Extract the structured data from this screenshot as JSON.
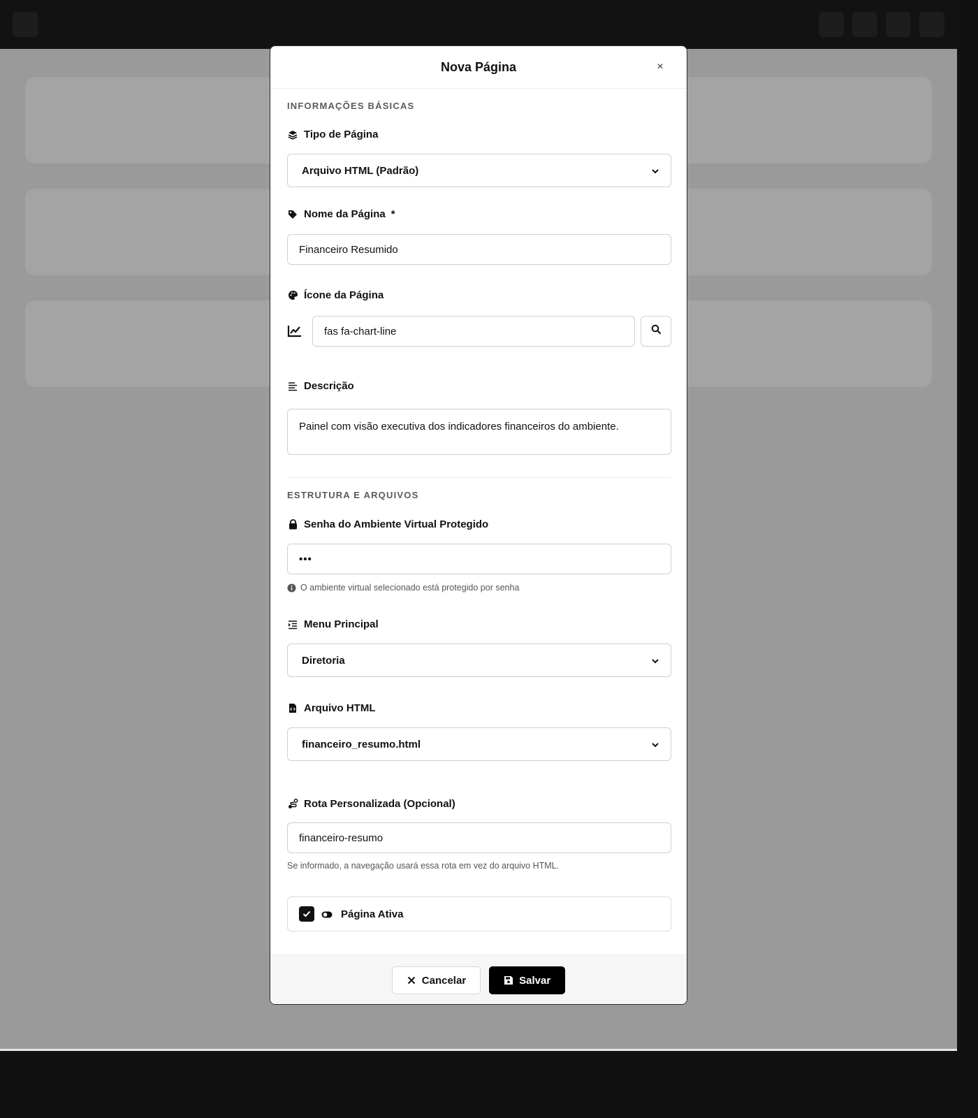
{
  "modal": {
    "title": "Nova Página",
    "close_label": "×"
  },
  "sections": {
    "basic": "INFORMAÇÕES BÁSICAS",
    "structure": "ESTRUTURA E ARQUIVOS"
  },
  "fields": {
    "page_type": {
      "label": "Tipo de Página",
      "value": "Arquivo HTML (Padrão)",
      "icon": "layers-icon"
    },
    "page_name": {
      "label": "Nome da Página",
      "required_mark": "*",
      "value": "Financeiro Resumido",
      "icon": "tag-icon"
    },
    "page_icon": {
      "label": "Ícone da Página",
      "value": "fas fa-chart-line",
      "icon": "palette-icon",
      "preview_icon": "chart-line-icon"
    },
    "description": {
      "label": "Descrição",
      "value": "Painel com visão executiva dos indicadores financeiros do ambiente.",
      "icon": "align-left-icon"
    },
    "password": {
      "label": "Senha do Ambiente Virtual Protegido",
      "value": "•••",
      "help": "O ambiente virtual selecionado está protegido por senha",
      "icon": "lock-icon"
    },
    "main_menu": {
      "label": "Menu Principal",
      "value": "Diretoria",
      "icon": "indent-icon"
    },
    "html_file": {
      "label": "Arquivo HTML",
      "value": "financeiro_resumo.html",
      "icon": "file-code-icon"
    },
    "custom_route": {
      "label": "Rota Personalizada (Opcional)",
      "value": "financeiro-resumo",
      "help": "Se informado, a navegação usará essa rota em vez do arquivo HTML.",
      "icon": "route-icon"
    },
    "active": {
      "label": "Página Ativa",
      "checked": true
    }
  },
  "footer": {
    "cancel_label": "Cancelar",
    "save_label": "Salvar"
  }
}
